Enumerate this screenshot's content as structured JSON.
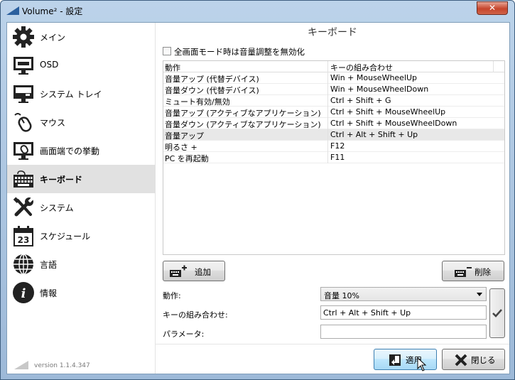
{
  "window": {
    "title": "Volume² - 設定",
    "close_glyph": "✕"
  },
  "sidebar": {
    "items": [
      {
        "label": "メイン",
        "icon": "gear-icon"
      },
      {
        "label": "OSD",
        "icon": "monitor-icon"
      },
      {
        "label": "システム トレイ",
        "icon": "system-tray-icon"
      },
      {
        "label": "マウス",
        "icon": "mouse-icon"
      },
      {
        "label": "画面端での挙動",
        "icon": "screen-edge-icon"
      },
      {
        "label": "キーボード",
        "icon": "keyboard-icon",
        "active": true
      },
      {
        "label": "システム",
        "icon": "tools-icon"
      },
      {
        "label": "スケジュール",
        "icon": "calendar-icon",
        "calendar_day": "23"
      },
      {
        "label": "言語",
        "icon": "globe-icon"
      },
      {
        "label": "情報",
        "icon": "info-icon",
        "glyph": "i"
      }
    ],
    "version": "version 1.1.4.347"
  },
  "main": {
    "title": "キーボード",
    "fullscreen_checkbox": {
      "label": "全画面モード時は音量調整を無効化",
      "checked": false
    },
    "table": {
      "headers": [
        "動作",
        "キーの組み合わせ"
      ],
      "rows": [
        [
          "音量アップ (代替デバイス)",
          "Win + MouseWheelUp"
        ],
        [
          "音量ダウン (代替デバイス)",
          "Win + MouseWheelDown"
        ],
        [
          "ミュート有効/無効",
          "Ctrl + Shift + G"
        ],
        [
          "音量アップ (アクティブなアプリケーション)",
          "Ctrl + Shift + MouseWheelUp"
        ],
        [
          "音量ダウン (アクティブなアプリケーション)",
          "Ctrl + Shift + MouseWheelDown"
        ],
        [
          "音量アップ",
          "Ctrl + Alt + Shift + Up"
        ],
        [
          "明るさ +",
          "F12"
        ],
        [
          "PC を再起動",
          "F11"
        ]
      ],
      "selected_row": 5
    },
    "add_button": "追加",
    "delete_button": "削除",
    "form": {
      "action_label": "動作:",
      "action_value": "音量 10%",
      "keys_label": "キーの組み合わせ:",
      "keys_value": "Ctrl + Alt + Shift + Up",
      "param_label": "パラメータ:",
      "param_value": ""
    },
    "apply_button": "適用",
    "close_button": "閉じる"
  },
  "colors": {
    "accent_blue": "#2a5f9e",
    "close_red": "#c5452c",
    "selected_bg": "#e1e1e1"
  }
}
